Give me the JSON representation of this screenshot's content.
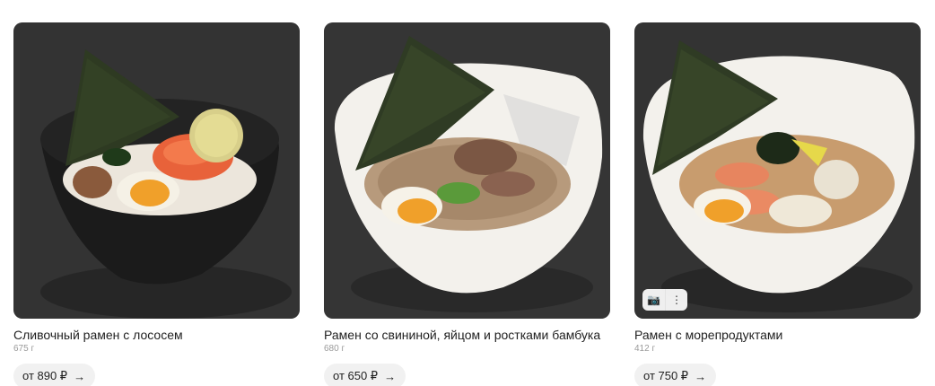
{
  "products": [
    {
      "title": "Сливочный рамен с лососем",
      "weight": "675 г",
      "price": "от 890 ₽",
      "arrow": "→"
    },
    {
      "title": "Рамен со свининой, яйцом и ростками бамбука",
      "weight": "680 г",
      "price": "от 650 ₽",
      "arrow": "→"
    },
    {
      "title": "Рамен с морепродуктами",
      "weight": "412 г",
      "price": "от 750 ₽",
      "arrow": "→"
    }
  ],
  "photo_tools": {
    "camera_icon": "📷",
    "more_icon": "⋮"
  },
  "colors": {
    "background": "#ffffff",
    "price_pill": "#f1f1f1",
    "weight_text": "#9a9a9a"
  }
}
